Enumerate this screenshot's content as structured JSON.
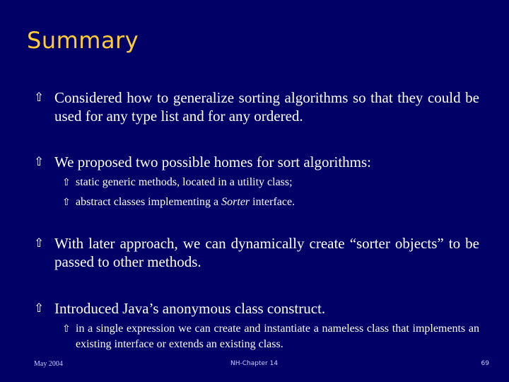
{
  "slide": {
    "title": "Summary",
    "bullet_icon": "⇧",
    "bullets": [
      {
        "text": "Considered how to generalize sorting algorithms so that they could be used for any type list and for any ordered."
      },
      {
        "text": "We proposed two possible homes for sort algorithms:",
        "subs": [
          {
            "text": "static generic methods, located in a utility class;"
          },
          {
            "pre": "abstract classes implementing a ",
            "em": "Sorter",
            "post": " interface."
          }
        ]
      },
      {
        "text": "With later approach, we can dynamically create “sorter objects” to be passed to other methods."
      },
      {
        "text": "Introduced Java’s anonymous class construct.",
        "subs": [
          {
            "text": "in a single expression we can create and instantiate a nameless class that implements an existing interface or extends an existing class."
          }
        ]
      }
    ]
  },
  "footer": {
    "date": "May 2004",
    "chapter": "NH-Chapter 14",
    "page": "69"
  },
  "colors": {
    "background": "#000066",
    "title": "#ffcc33",
    "text": "#ffffff"
  }
}
